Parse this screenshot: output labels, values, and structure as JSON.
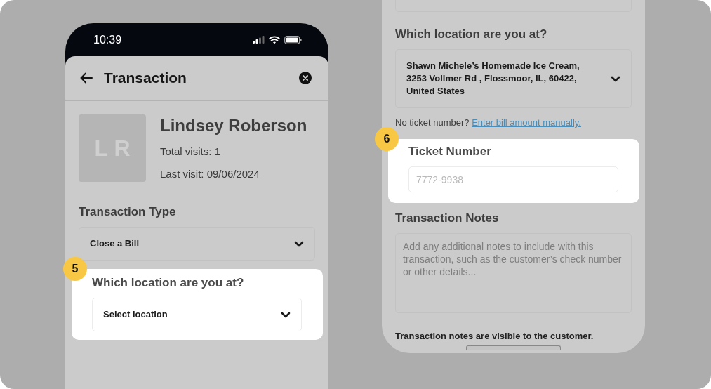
{
  "left_phone": {
    "status_bar": {
      "time": "10:39"
    },
    "header": {
      "title": "Transaction"
    },
    "customer": {
      "initials": "L R",
      "name": "Lindsey Roberson",
      "total_visits": "Total visits: 1",
      "last_visit": "Last visit: 09/06/2024"
    },
    "sections": [
      {
        "kind": "select",
        "label": "Transaction Type",
        "value": "Close a Bill",
        "highlighted": false
      },
      {
        "kind": "select",
        "label": "Which location are you at?",
        "value": "Select location",
        "highlighted": true,
        "step": "5"
      }
    ]
  },
  "right_phone": {
    "sections": [
      {
        "kind": "select",
        "label": "Which location are you at?",
        "value": "Shawn Michele’s Homemade Ice Cream, 3253 Vollmer Rd , Flossmoor, IL, 60422, United States",
        "highlighted": false
      },
      {
        "kind": "hint",
        "text": "No ticket number?",
        "link": "Enter bill amount manually."
      },
      {
        "kind": "input",
        "label": "Ticket Number",
        "placeholder": "7772-9938",
        "highlighted": true,
        "step": "6"
      },
      {
        "kind": "textarea",
        "label": "Transaction Notes",
        "placeholder": "Add any additional notes to include with this transaction, such as the customer’s check number or other details...",
        "highlighted": false
      },
      {
        "kind": "note",
        "text": "Transaction notes are visible to the customer."
      }
    ]
  }
}
